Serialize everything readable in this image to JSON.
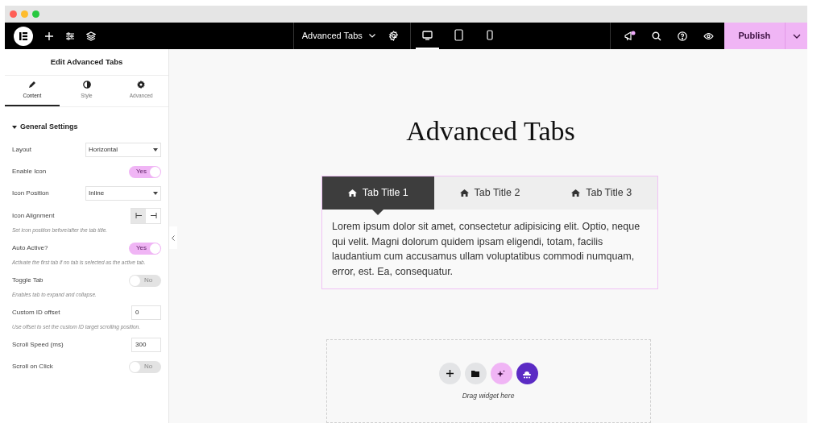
{
  "topbar": {
    "document_title": "Advanced Tabs",
    "devices": [
      {
        "kind": "desktop",
        "selected": true
      },
      {
        "kind": "tablet",
        "selected": false
      },
      {
        "kind": "mobile",
        "selected": false
      }
    ],
    "publish": "Publish"
  },
  "panel": {
    "title": "Edit Advanced Tabs",
    "tabs": [
      {
        "label": "Content",
        "selected": true
      },
      {
        "label": "Style",
        "selected": false
      },
      {
        "label": "Advanced",
        "selected": false
      }
    ],
    "section": {
      "title": "General Settings",
      "expanded": true
    },
    "controls": [
      {
        "kind": "select",
        "label": "Layout",
        "value": "Horizontal"
      },
      {
        "kind": "switch",
        "label": "Enable Icon",
        "on": true,
        "text": "Yes"
      },
      {
        "kind": "select",
        "label": "Icon Position",
        "value": "Inline"
      },
      {
        "kind": "align",
        "label": "Icon Alignment",
        "help": "Set icon position before/after the tab title."
      },
      {
        "kind": "switch",
        "label": "Auto Active?",
        "on": true,
        "text": "Yes",
        "help": "Activate the first tab if no tab is selected as the active tab."
      },
      {
        "kind": "switch",
        "label": "Toggle Tab",
        "on": false,
        "text": "No",
        "help": "Enables tab to expand and collapse."
      },
      {
        "kind": "number",
        "label": "Custom ID offset",
        "value": "0",
        "help": "Use offset to set the custom ID target scrolling position."
      },
      {
        "kind": "number",
        "label": "Scroll Speed (ms)",
        "value": "300"
      },
      {
        "kind": "switch",
        "label": "Scroll on Click",
        "on": false,
        "text": "No"
      }
    ]
  },
  "canvas": {
    "heading": "Advanced Tabs",
    "tabs": [
      {
        "label": "Tab Title 1",
        "selected": true
      },
      {
        "label": "Tab Title 2",
        "selected": false
      },
      {
        "label": "Tab Title 3",
        "selected": false
      }
    ],
    "content": "Lorem ipsum dolor sit amet, consectetur adipisicing elit. Optio, neque qui velit. Magni dolorum quidem ipsam eligendi, totam, facilis laudantium cum accusamus ullam voluptatibus commodi numquam, error, est. Ea, consequatur.",
    "drop_hint": "Drag widget here"
  }
}
